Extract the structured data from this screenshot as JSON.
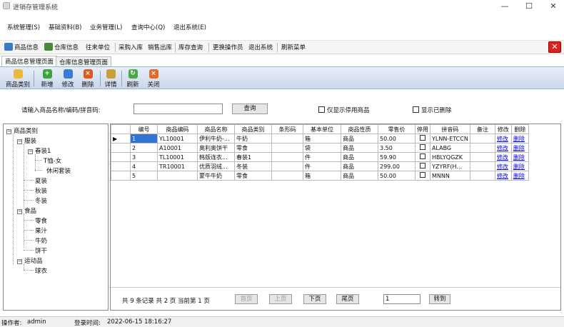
{
  "window": {
    "title": "进销存管理系统",
    "minimize": "—",
    "maximize": "☐",
    "close": "✕"
  },
  "menubar": [
    "系统管理(S)",
    "基础资料(B)",
    "业务管理(L)",
    "查询中心(Q)",
    "退出系统(E)"
  ],
  "toolbar1": [
    "商品信息",
    "仓库信息",
    "往来单位",
    "采购入库",
    "销售出库",
    "库存查询",
    "更换操作员",
    "退出系统",
    "刷新菜单"
  ],
  "tabs": [
    "商品信息管理页面",
    "仓库信息管理页面"
  ],
  "toolbar2": [
    "商品类别",
    "新增",
    "修改",
    "删除",
    "详情",
    "刷新",
    "关闭"
  ],
  "search": {
    "label": "请输入商品名称/编码/拼音码:",
    "value": "",
    "button": "查询",
    "only_disabled": "仅显示停用商品",
    "show_deleted": "显示已删除"
  },
  "tree": {
    "root": "商品类别",
    "nodes": [
      "服装",
      "春装1",
      "T恤-女",
      "休闲套装",
      "夏装",
      "秋装",
      "冬装",
      "食品",
      "零食",
      "果汁",
      "牛奶",
      "饼干",
      "运动品",
      "球衣"
    ]
  },
  "grid": {
    "columns": [
      "编号",
      "商品编码",
      "商品名称",
      "商品类别",
      "条形码",
      "基本单位",
      "商品性质",
      "零售价",
      "停用",
      "拼音码",
      "备注",
      "修改",
      "删除"
    ],
    "rows": [
      {
        "id": "1",
        "code": "YL10001",
        "name": "伊利牛奶-...",
        "category": "牛奶",
        "barcode": "",
        "unit": "箱",
        "nature": "商品",
        "price": "50.00",
        "pinyin": "YLNN-ETCCN",
        "remark": "",
        "edit": "修改",
        "delete": "删除"
      },
      {
        "id": "2",
        "code": "A10001",
        "name": "奥利奥饼干",
        "category": "零食",
        "barcode": "",
        "unit": "袋",
        "nature": "商品",
        "price": "3.50",
        "pinyin": "ALABG",
        "remark": "",
        "edit": "修改",
        "delete": "删除"
      },
      {
        "id": "3",
        "code": "TL10001",
        "name": "韩版连衣...",
        "category": "春装1",
        "barcode": "",
        "unit": "件",
        "nature": "商品",
        "price": "59.90",
        "pinyin": "HBLYQGZK",
        "remark": "",
        "edit": "修改",
        "delete": "删除"
      },
      {
        "id": "4",
        "code": "TR10001",
        "name": "优质羽绒...",
        "category": "冬装",
        "barcode": "",
        "unit": "件",
        "nature": "商品",
        "price": "299.00",
        "pinyin": "YZYRF(H...",
        "remark": "",
        "edit": "修改",
        "delete": "删除"
      },
      {
        "id": "5",
        "code": "",
        "name": "蒙牛牛奶",
        "category": "零食",
        "barcode": "",
        "unit": "箱",
        "nature": "商品",
        "price": "50.00",
        "pinyin": "MNNN",
        "remark": "",
        "edit": "修改",
        "delete": "删除"
      }
    ]
  },
  "pager": {
    "summary": "共 9 条记录  共 2 页  当前第 1 页",
    "first": "首页",
    "prev": "上页",
    "next": "下页",
    "last": "尾页",
    "page_input": "1",
    "goto": "转到"
  },
  "status": {
    "operator_label": "操作者:",
    "operator": "admin",
    "login_label": "登录时间:",
    "login_time": "2022-06-15 18:16:27"
  }
}
